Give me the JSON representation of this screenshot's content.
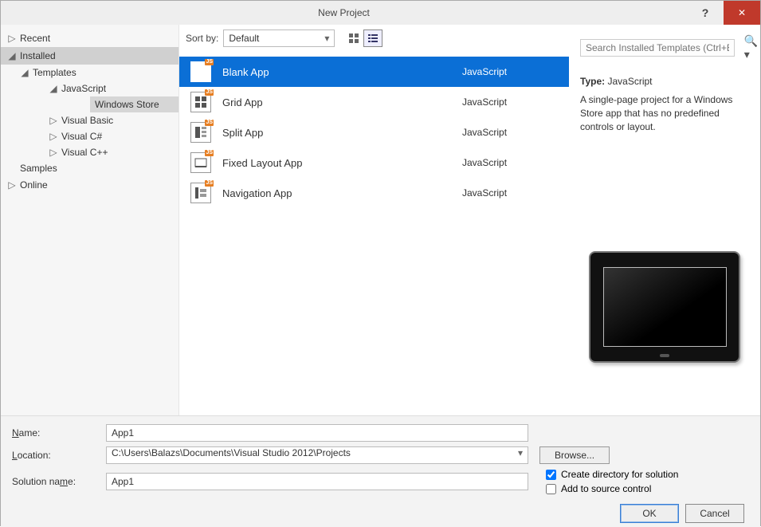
{
  "titlebar": {
    "title": "New Project",
    "help": "?",
    "close": "✕"
  },
  "left": {
    "recent": "Recent",
    "installed": "Installed",
    "templates": "Templates",
    "javascript": "JavaScript",
    "windows_store": "Windows Store",
    "visual_basic": "Visual Basic",
    "visual_csharp": "Visual C#",
    "visual_cpp": "Visual C++",
    "samples": "Samples",
    "online": "Online"
  },
  "toolbar": {
    "sort_by_label": "Sort by:",
    "sort_by_value": "Default",
    "search_placeholder": "Search Installed Templates (Ctrl+E)"
  },
  "templates": [
    {
      "name": "Blank App",
      "lang": "JavaScript",
      "selected": true
    },
    {
      "name": "Grid App",
      "lang": "JavaScript",
      "selected": false
    },
    {
      "name": "Split App",
      "lang": "JavaScript",
      "selected": false
    },
    {
      "name": "Fixed Layout App",
      "lang": "JavaScript",
      "selected": false
    },
    {
      "name": "Navigation App",
      "lang": "JavaScript",
      "selected": false
    }
  ],
  "info": {
    "type_label": "Type:",
    "type_value": "JavaScript",
    "description": "A single-page project for a Windows Store app that has no predefined controls or layout."
  },
  "form": {
    "name_label": "Name:",
    "name_value": "App1",
    "location_label": "Location:",
    "location_value": "C:\\Users\\Balazs\\Documents\\Visual Studio 2012\\Projects",
    "browse_label": "Browse...",
    "solution_label": "Solution name:",
    "solution_value": "App1",
    "create_dir_label": "Create directory for solution",
    "source_control_label": "Add to source control",
    "ok": "OK",
    "cancel": "Cancel"
  }
}
